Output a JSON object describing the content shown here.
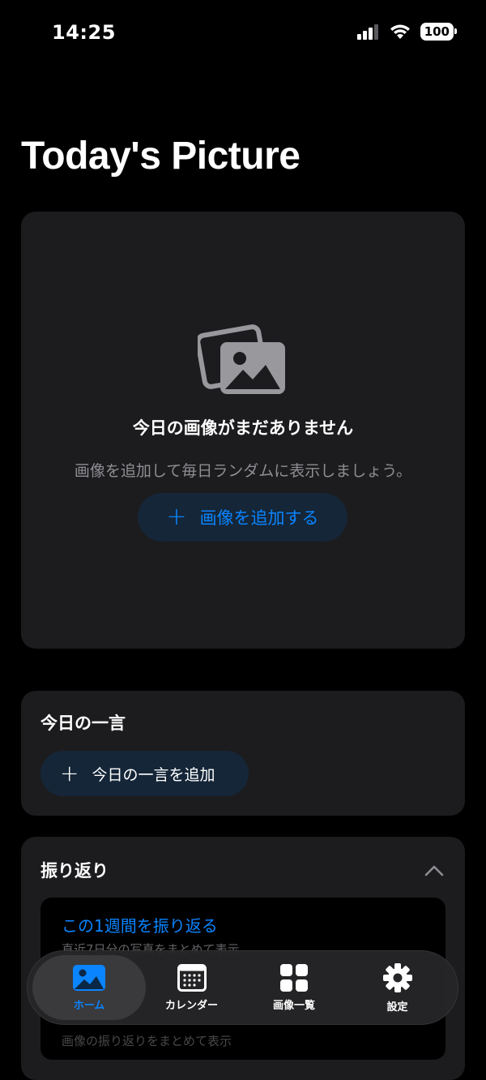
{
  "status": {
    "time": "14:25",
    "battery": "100"
  },
  "title": "Today's Picture",
  "hero": {
    "empty_title": "今日の画像がまだありません",
    "empty_subtitle": "画像を追加して毎日ランダムに表示しましょう。",
    "add_button": "画像を追加する",
    "add_icon": "plus-icon"
  },
  "quote": {
    "title": "今日の一言",
    "add_button": "今日の一言を追加"
  },
  "review": {
    "title": "振り返り",
    "link": "この1週間を振り返る",
    "subtitle": "直近7日分の写真をまとめて表示",
    "ghost_link": "",
    "ghost_sub": "画像の振り返りをまとめて表示"
  },
  "tabs": [
    {
      "label": "ホーム",
      "icon": "photo-icon",
      "active": true
    },
    {
      "label": "カレンダー",
      "icon": "calendar-icon",
      "active": false
    },
    {
      "label": "画像一覧",
      "icon": "grid-icon",
      "active": false
    },
    {
      "label": "設定",
      "icon": "gear-icon",
      "active": false
    }
  ],
  "colors": {
    "accent": "#0a84ff",
    "card": "#1c1c1e",
    "background": "#000000"
  }
}
